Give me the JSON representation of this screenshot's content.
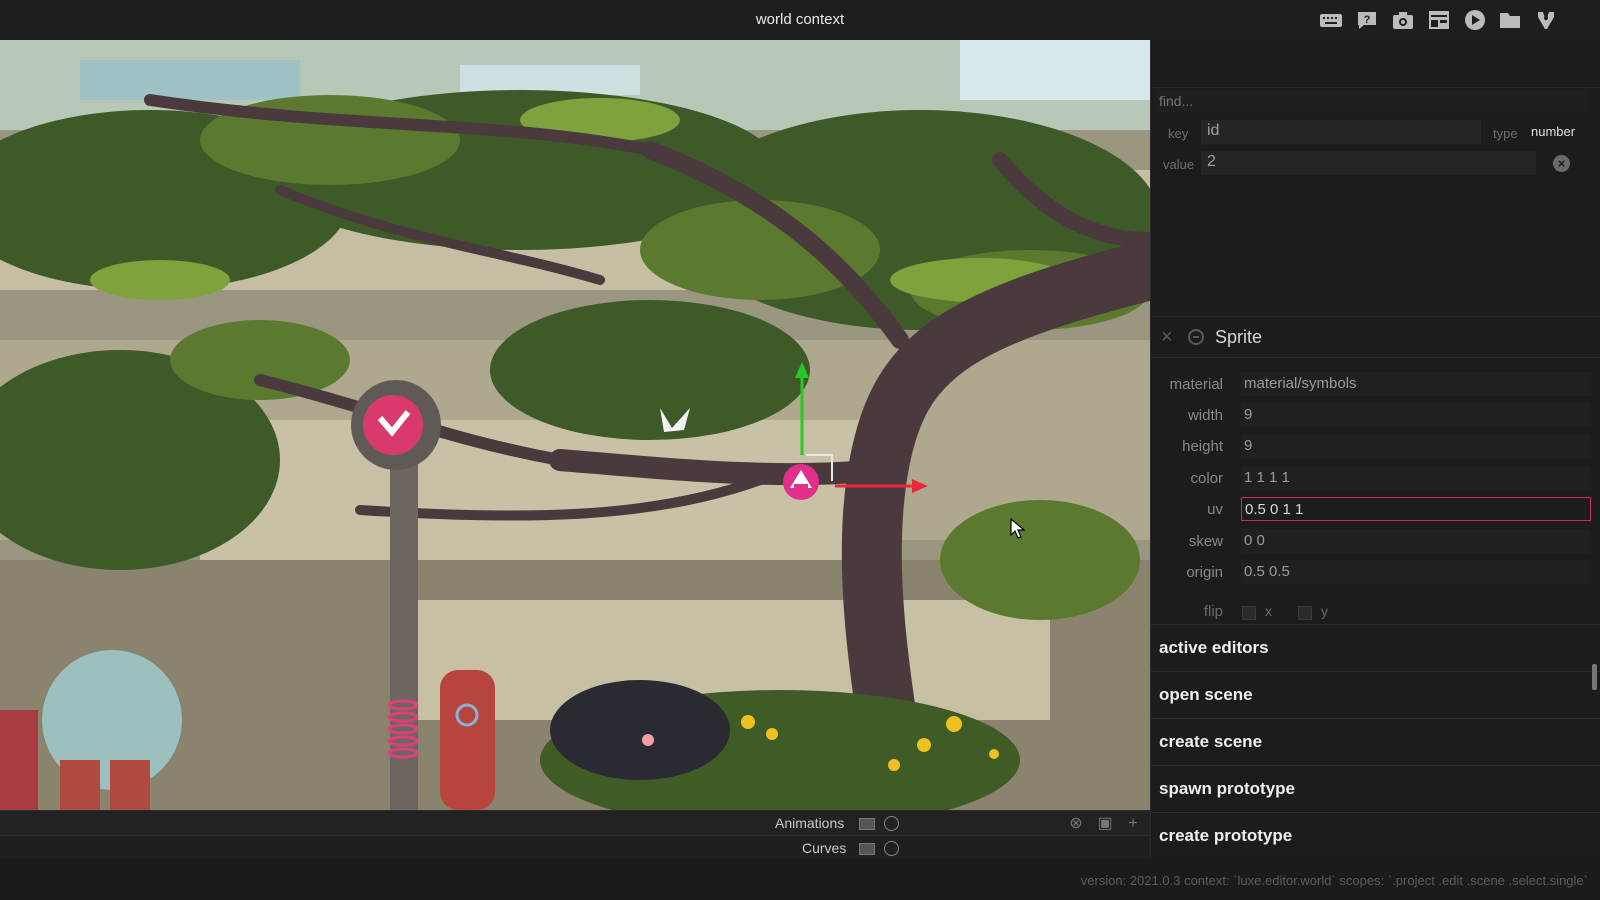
{
  "window": {
    "title": "world context"
  },
  "toolbar": {
    "icons": [
      "keyboard-icon",
      "help-icon",
      "camera-icon",
      "layout-icon",
      "play-icon",
      "folder-icon",
      "luxe-logo-icon"
    ]
  },
  "viewport": {
    "description_icons": [
      "pink-sprite-marker-icon",
      "translate-gizmo-icon"
    ]
  },
  "editors": {
    "animations_label": "Animations",
    "curves_label": "Curves"
  },
  "status": {
    "text": "version: 2021.0.3 context: `luxe.editor.world` scopes: `.project .edit .scene .select.single`"
  },
  "inspector": {
    "find_placeholder": "find...",
    "key_label": "key",
    "key_value": "id",
    "type_label": "type",
    "type_value": "number",
    "value_label": "value",
    "value_value": "2"
  },
  "sprite": {
    "title": "Sprite",
    "properties": [
      {
        "label": "material",
        "value": "material/symbols"
      },
      {
        "label": "width",
        "value": "9"
      },
      {
        "label": "height",
        "value": "9"
      },
      {
        "label": "color",
        "value": "1 1 1 1"
      },
      {
        "label": "uv",
        "value": "0.5 0 1 1"
      },
      {
        "label": "skew",
        "value": "0 0"
      },
      {
        "label": "origin",
        "value": "0.5 0.5"
      }
    ],
    "flip_label": "flip",
    "flip_x": "x",
    "flip_y": "y"
  },
  "actions": [
    "active editors",
    "open scene",
    "create scene",
    "spawn prototype",
    "create prototype"
  ],
  "colors": {
    "accent": "#d0285a",
    "gizmo_x": "#e8283c",
    "gizmo_y": "#28c828",
    "panel_bg": "#1c1c1f"
  }
}
